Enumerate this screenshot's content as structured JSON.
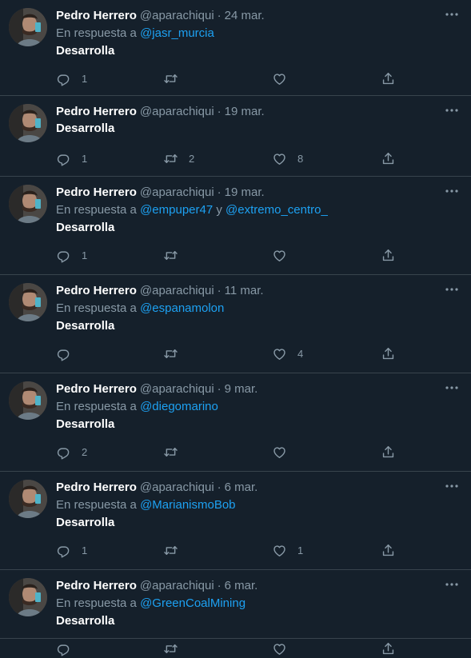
{
  "author": {
    "name": "Pedro Herrero",
    "handle": "@aparachiqui"
  },
  "reply_prefix": "En respuesta a",
  "reply_joiner": "y",
  "separator": "·",
  "colors": {
    "background": "#15202b",
    "divider": "#38444d",
    "secondary_text": "#8899a6",
    "mention": "#1da1f2"
  },
  "icons": [
    "more-icon",
    "reply-icon",
    "retweet-icon",
    "like-icon",
    "share-icon"
  ],
  "tweets": [
    {
      "date": "24 mar.",
      "reply_to": [
        "@jasr_murcia"
      ],
      "text": "Desarrolla",
      "replies": "1",
      "retweets": "",
      "likes": ""
    },
    {
      "date": "19 mar.",
      "reply_to": [],
      "text": "Desarrolla",
      "replies": "1",
      "retweets": "2",
      "likes": "8"
    },
    {
      "date": "19 mar.",
      "reply_to": [
        "@empuper47",
        "@extremo_centro_"
      ],
      "text": "Desarrolla",
      "replies": "1",
      "retweets": "",
      "likes": ""
    },
    {
      "date": "11 mar.",
      "reply_to": [
        "@espanamolon"
      ],
      "text": "Desarrolla",
      "replies": "",
      "retweets": "",
      "likes": "4"
    },
    {
      "date": "9 mar.",
      "reply_to": [
        "@diegomarino"
      ],
      "text": "Desarrolla",
      "replies": "2",
      "retweets": "",
      "likes": ""
    },
    {
      "date": "6 mar.",
      "reply_to": [
        "@MarianismoBob"
      ],
      "text": "Desarrolla",
      "replies": "1",
      "retweets": "",
      "likes": "1"
    },
    {
      "date": "6 mar.",
      "reply_to": [
        "@GreenCoalMining"
      ],
      "text": "Desarrolla",
      "replies": "",
      "retweets": "",
      "likes": ""
    }
  ]
}
